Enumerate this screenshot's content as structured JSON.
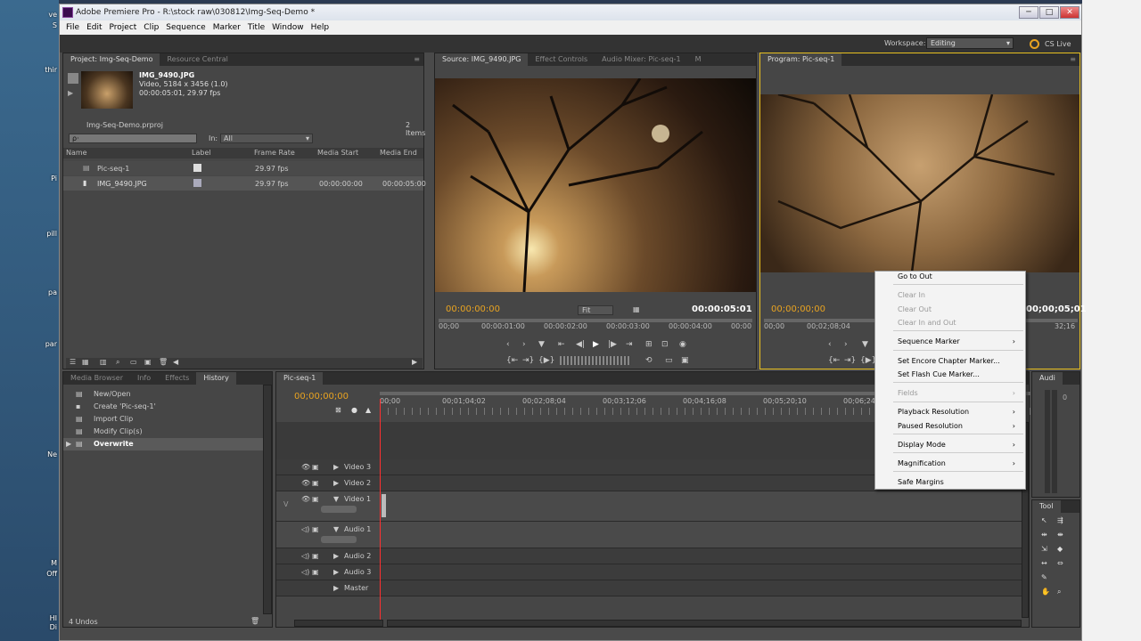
{
  "desktop": {
    "items": [
      "ve",
      "S",
      "thir",
      "Pi",
      "pill",
      "pa",
      "par",
      "Ne",
      "M",
      "Off",
      "HI",
      "Di"
    ]
  },
  "titlebar": {
    "title": "Adobe Premiere Pro - R:\\stock raw\\030812\\Img-Seq-Demo *",
    "min": "─",
    "max": "□",
    "close": "✕"
  },
  "menu": [
    "File",
    "Edit",
    "Project",
    "Clip",
    "Sequence",
    "Marker",
    "Title",
    "Window",
    "Help"
  ],
  "workspace": {
    "label": "Workspace:",
    "value": "Editing",
    "cslive": "CS Live"
  },
  "project": {
    "tabs": [
      "Project: Img-Seq-Demo",
      "Resource Central"
    ],
    "clip_name": "IMG_9490.JPG",
    "clip_info1": "Video, 5184 x 3456 (1.0)",
    "clip_info2": "00:00:05:01, 29.97 fps",
    "file": "Img-Seq-Demo.prproj",
    "count": "2 Items",
    "in_label": "In:",
    "in_value": "All",
    "search_placeholder": "ρ·",
    "columns": [
      "Name",
      "Label",
      "Frame Rate",
      "Media Start",
      "Media End"
    ],
    "rows": [
      {
        "name": "Pic-seq-1",
        "rate": "29.97 fps",
        "start": "",
        "end": ""
      },
      {
        "name": "IMG_9490.JPG",
        "rate": "29.97 fps",
        "start": "00:00:00:00",
        "end": "00:00:05:00"
      }
    ]
  },
  "source": {
    "tabs": [
      "Source: IMG_9490.JPG",
      "Effect Controls",
      "Audio Mixer: Pic-seq-1"
    ],
    "menu_glyph": "M",
    "tc_in": "00:00:00:00",
    "fit": "Fit",
    "tc_out": "00:00:05:01",
    "ruler": [
      "00;00",
      "00:00:01:00",
      "00:00:02:00",
      "00:00:03:00",
      "00:00:04:00",
      "00:00"
    ]
  },
  "program": {
    "tab": "Program: Pic-seq-1",
    "tc_in": "00;00;00;00",
    "tc_out": "00;00;05;01",
    "ruler": [
      "00;00",
      "00;02;08;04",
      "32;16"
    ]
  },
  "history": {
    "tabs": [
      "Media Browser",
      "Info",
      "Effects",
      "History"
    ],
    "items": [
      "New/Open",
      "Create 'Pic-seq-1'",
      "Import Clip",
      "Modify Clip(s)",
      "Overwrite"
    ],
    "undos": "4 Undos"
  },
  "timeline": {
    "tab": "Pic-seq-1",
    "tc": "00;00;00;00",
    "ruler": [
      "00;00",
      "00;01;04;02",
      "00;02;08;04",
      "00;03;12;06",
      "00;04;16;08",
      "00;05;20;10",
      "00;06;24;1"
    ],
    "tracks": [
      "Video 3",
      "Video 2",
      "Video 1",
      "Audio 1",
      "Audio 2",
      "Audio 3",
      "Master"
    ],
    "v_label": "V"
  },
  "audio_panel": {
    "tab": "Audi",
    "levels": [
      "0",
      "-",
      "-",
      "-",
      "-",
      "-"
    ]
  },
  "tools_panel": {
    "tab": "Tool"
  },
  "context_menu": {
    "items": [
      {
        "label": "Go to Out",
        "disabled": false,
        "sub": false
      },
      {
        "label": "Clear In",
        "disabled": true,
        "sub": false
      },
      {
        "label": "Clear Out",
        "disabled": true,
        "sub": false
      },
      {
        "label": "Clear In and Out",
        "disabled": true,
        "sub": false
      },
      {
        "label": "Sequence Marker",
        "disabled": false,
        "sub": true
      },
      {
        "label": "Set Encore Chapter Marker...",
        "disabled": false,
        "sub": false
      },
      {
        "label": "Set Flash Cue Marker...",
        "disabled": false,
        "sub": false
      },
      {
        "label": "Fields",
        "disabled": true,
        "sub": true
      },
      {
        "label": "Playback Resolution",
        "disabled": false,
        "sub": true
      },
      {
        "label": "Paused Resolution",
        "disabled": false,
        "sub": true
      },
      {
        "label": "Display Mode",
        "disabled": false,
        "sub": true
      },
      {
        "label": "Magnification",
        "disabled": false,
        "sub": true
      },
      {
        "label": "Safe Margins",
        "disabled": false,
        "sub": false
      }
    ],
    "arrow": "›"
  },
  "colors": {
    "accent": "#e8a321",
    "panel": "#464646",
    "playhead": "#ff3030"
  }
}
